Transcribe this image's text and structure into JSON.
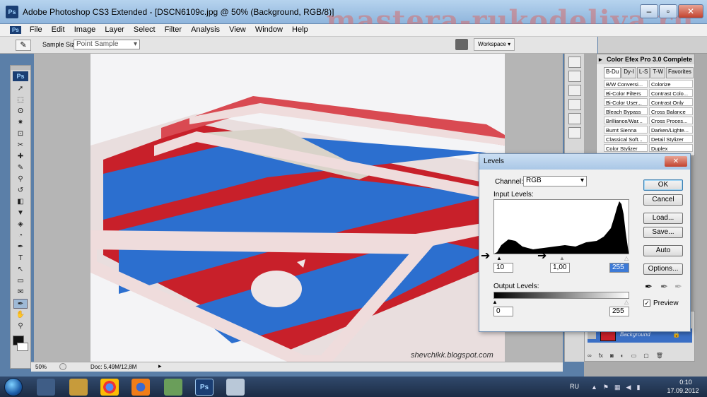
{
  "window": {
    "app_logo": "Ps",
    "title": "Adobe Photoshop CS3 Extended - [DSCN6109c.jpg @ 50% (Background, RGB/8)]"
  },
  "watermark": "mastera-rukodeliya.ru",
  "menu": [
    "File",
    "Edit",
    "Image",
    "Layer",
    "Select",
    "Filter",
    "Analysis",
    "View",
    "Window",
    "Help"
  ],
  "options_bar": {
    "sample_size_label": "Sample Size:",
    "sample_size_value": "Point Sample",
    "workspace_label": "Workspace"
  },
  "tools": [
    "move-tool",
    "marquee-tool",
    "lasso-tool",
    "magic-wand-tool",
    "crop-tool",
    "slice-tool",
    "healing-tool",
    "brush-tool",
    "clone-tool",
    "history-brush-tool",
    "eraser-tool",
    "paint-bucket-tool",
    "blur-tool",
    "dodge-tool",
    "pen-tool",
    "type-tool",
    "path-select-tool",
    "shape-tool",
    "notes-tool",
    "eyedropper-tool",
    "hand-tool",
    "zoom-tool"
  ],
  "tools_logo": "Ps",
  "photo": {
    "caption": "shevchikk.blogspot.com",
    "colors": {
      "red": "#c8202a",
      "blue": "#2c6fcf",
      "trim": "#e7c7c9"
    }
  },
  "status": {
    "zoom": "50%",
    "doc": "Doc: 5,49M/12,8M"
  },
  "color_efex": {
    "title": "Color Efex Pro 3.0 Complete",
    "tabs": [
      "B-Du",
      "Dy-I",
      "L-S",
      "T-W",
      "Favorites"
    ],
    "filters": [
      [
        "B/W Conversi...",
        "Colorize"
      ],
      [
        "Bi-Color Filters",
        "Contrast Colo..."
      ],
      [
        "Bi-Color User...",
        "Contrast Only"
      ],
      [
        "Bleach Bypass",
        "Cross Balance"
      ],
      [
        "Brilliance/War...",
        "Cross Proces..."
      ],
      [
        "Burnt Sienna",
        "Darken/Lighte..."
      ],
      [
        "Classical Soft...",
        "Detail Stylizer"
      ],
      [
        "Color Stylizer",
        "Duplex"
      ]
    ]
  },
  "layers": {
    "layer_name": "Background"
  },
  "levels": {
    "title": "Levels",
    "channel_label": "Channel:",
    "channel_value": "RGB",
    "input_label": "Input Levels:",
    "input_black": "10",
    "input_gamma": "1,00",
    "input_white": "255",
    "output_label": "Output Levels:",
    "output_black": "0",
    "output_white": "255",
    "buttons": {
      "ok": "OK",
      "cancel": "Cancel",
      "load": "Load...",
      "save": "Save...",
      "auto": "Auto",
      "options": "Options..."
    },
    "preview_label": "Preview",
    "preview_checked": true
  },
  "taskbar": {
    "lang": "RU",
    "time": "0:10",
    "date": "17.09.2012"
  }
}
